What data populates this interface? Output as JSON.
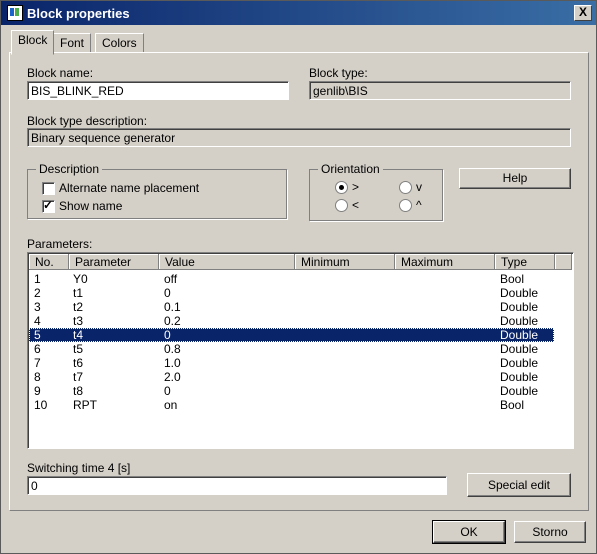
{
  "window": {
    "title": "Block properties",
    "close_label": "X"
  },
  "tabs": [
    {
      "label": "Block"
    },
    {
      "label": "Font"
    },
    {
      "label": "Colors"
    }
  ],
  "block": {
    "name_label": "Block name:",
    "name_value": "BIS_BLINK_RED",
    "type_label": "Block type:",
    "type_value": "genlib\\BIS",
    "desc_label": "Block type description:",
    "desc_value": "Binary sequence generator"
  },
  "description_group": {
    "title": "Description",
    "alt_label": "Alternate name placement",
    "alt_checked": false,
    "show_label": "Show name",
    "show_checked": true
  },
  "orientation_group": {
    "title": "Orientation",
    "options": [
      {
        "label": ">",
        "selected": true
      },
      {
        "label": "v",
        "selected": false
      },
      {
        "label": "<",
        "selected": false
      },
      {
        "label": "^",
        "selected": false
      }
    ]
  },
  "help_label": "Help",
  "parameters": {
    "label": "Parameters:",
    "columns": [
      "No.",
      "Parameter",
      "Value",
      "Minimum",
      "Maximum",
      "Type"
    ],
    "rows": [
      [
        "1",
        "Y0",
        "off",
        "",
        "",
        "Bool"
      ],
      [
        "2",
        "t1",
        "0",
        "",
        "",
        "Double"
      ],
      [
        "3",
        "t2",
        "0.1",
        "",
        "",
        "Double"
      ],
      [
        "4",
        "t3",
        "0.2",
        "",
        "",
        "Double"
      ],
      [
        "5",
        "t4",
        "0",
        "",
        "",
        "Double"
      ],
      [
        "6",
        "t5",
        "0.8",
        "",
        "",
        "Double"
      ],
      [
        "7",
        "t6",
        "1.0",
        "",
        "",
        "Double"
      ],
      [
        "8",
        "t7",
        "2.0",
        "",
        "",
        "Double"
      ],
      [
        "9",
        "t8",
        "0",
        "",
        "",
        "Double"
      ],
      [
        "10",
        "RPT",
        "on",
        "",
        "",
        "Bool"
      ]
    ],
    "selected_row": 4
  },
  "switching": {
    "label": "Switching time 4 [s]",
    "value": "0"
  },
  "special_edit_label": "Special edit",
  "ok_label": "OK",
  "cancel_label": "Storno"
}
